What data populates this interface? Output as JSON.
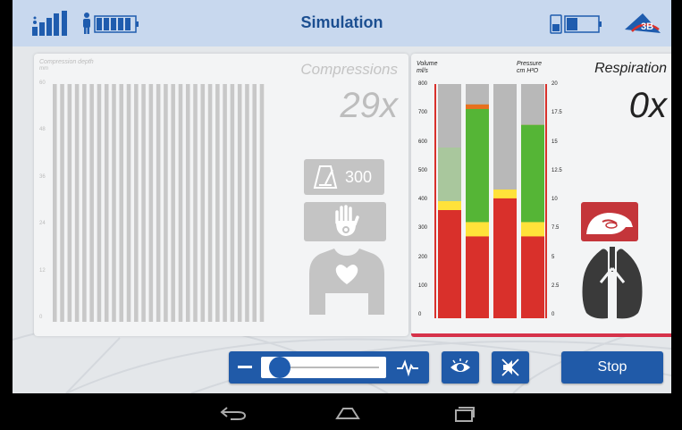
{
  "topbar": {
    "title": "Simulation",
    "icons": [
      "signal-strength-icon",
      "manikin-battery-icon",
      "device-battery-icon",
      "3b-logo"
    ]
  },
  "compressions": {
    "axis_label": "Compression depth",
    "axis_unit": "mm",
    "y_ticks": [
      "60",
      "48",
      "36",
      "24",
      "12",
      "0"
    ],
    "title": "Compressions",
    "count": "29x",
    "metronome_rate": "300",
    "bar_count": 29
  },
  "respiration": {
    "left_axis_label": "Volume",
    "left_axis_unit": "ml/s",
    "right_axis_label": "Pressure",
    "right_axis_unit": "cm H²O",
    "left_ticks": [
      "800",
      "700",
      "600",
      "500",
      "400",
      "300",
      "200",
      "100",
      "0"
    ],
    "right_ticks": [
      "20",
      "17.5",
      "15",
      "12.5",
      "10",
      "7.5",
      "5",
      "2.5",
      "0"
    ],
    "title": "Respiration",
    "count": "0x",
    "gauges": [
      {
        "type": "volume",
        "level": 400
      },
      {
        "type": "volume",
        "level": 730
      },
      {
        "type": "pressure",
        "level": 11
      },
      {
        "type": "pressure",
        "level": 16.5
      }
    ]
  },
  "controls": {
    "slider_value": 0.08,
    "stop_label": "Stop"
  },
  "colors": {
    "accent_blue": "#205aa8",
    "red": "#d9302b",
    "yellow": "#ffe23a",
    "green": "#55b536",
    "inactive_grey": "#c4c4c4"
  }
}
